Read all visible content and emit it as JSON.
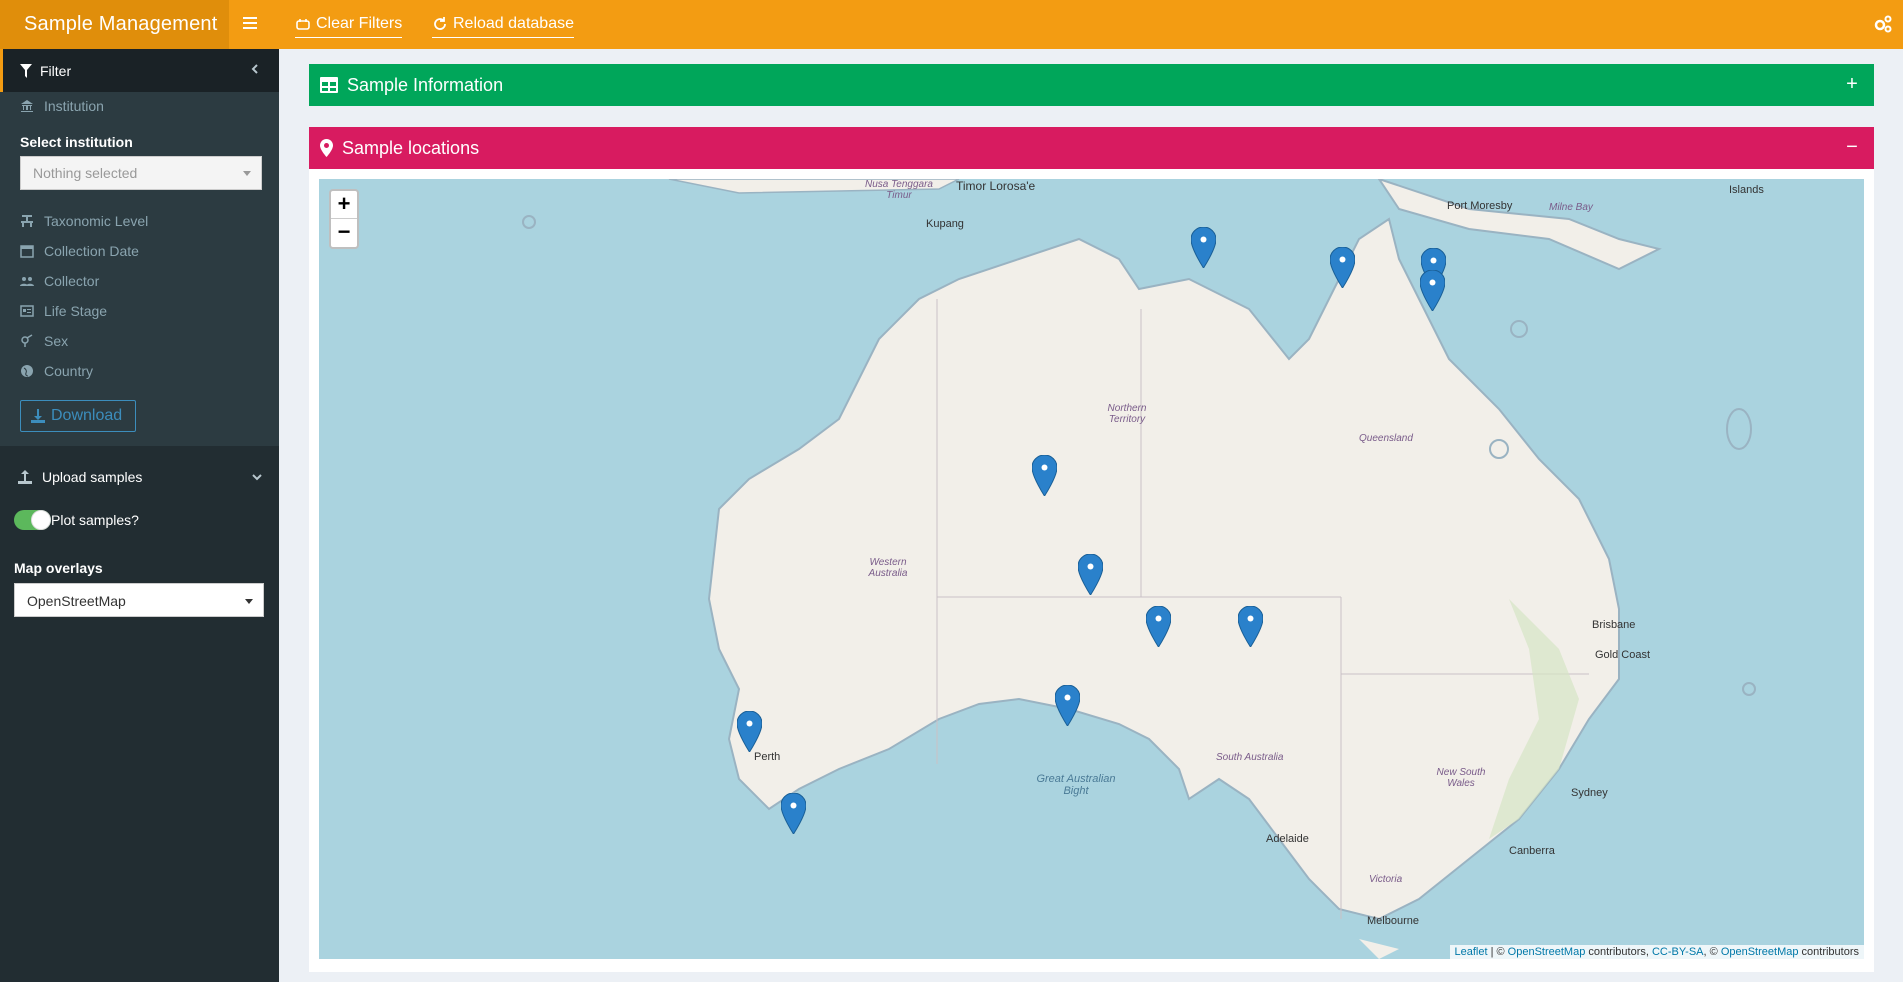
{
  "header": {
    "brand": "Sample Management",
    "clear_filters": "Clear Filters",
    "reload_database": "Reload database"
  },
  "sidebar": {
    "filter_title": "Filter",
    "institution": "Institution",
    "select_institution_label": "Select institution",
    "select_institution_placeholder": "Nothing selected",
    "items": [
      {
        "label": "Taxonomic Level",
        "icon": "sitemap-icon"
      },
      {
        "label": "Collection Date",
        "icon": "calendar-icon"
      },
      {
        "label": "Collector",
        "icon": "users-icon"
      },
      {
        "label": "Life Stage",
        "icon": "id-card-icon"
      },
      {
        "label": "Sex",
        "icon": "venus-mars-icon"
      },
      {
        "label": "Country",
        "icon": "globe-icon"
      }
    ],
    "download": "Download",
    "upload_samples": "Upload samples",
    "plot_samples": "Plot samples?",
    "plot_samples_on": true,
    "map_overlays_label": "Map overlays",
    "map_overlays_value": "OpenStreetMap"
  },
  "boxes": {
    "sample_information": "Sample Information",
    "sample_locations": "Sample locations",
    "expand_symbol": "+",
    "collapse_symbol": "−"
  },
  "map": {
    "zoom_in": "+",
    "zoom_out": "−",
    "attribution": {
      "leaflet": "Leaflet",
      "sep1": " | © ",
      "osm1": "OpenStreetMap",
      "mid": " contributors, ",
      "ccbysa": "CC-BY-SA",
      "sep2": ", © ",
      "osm2": "OpenStreetMap",
      "end": " contributors"
    },
    "labels": {
      "nusa_tenggara": "Nusa Tenggara Timur",
      "timor": "Timor Lorosa'e",
      "kupang": "Kupang",
      "port_moresby": "Port Moresby",
      "milne_bay": "Milne Bay",
      "islands": "Islands",
      "northern_territory": "Northern Territory",
      "queensland": "Queensland",
      "western_australia": "Western Australia",
      "south_australia": "South Australia",
      "new_south_wales": "New South Wales",
      "victoria": "Victoria",
      "great_australian_bight": "Great Australian Bight",
      "perth": "Perth",
      "adelaide": "Adelaide",
      "brisbane": "Brisbane",
      "gold_coast": "Gold Coast",
      "sydney": "Sydney",
      "canberra": "Canberra",
      "melbourne": "Melbourne"
    },
    "marker_count": 12
  },
  "colors": {
    "header": "#f39c12",
    "brand_bg": "#e08e0b",
    "sidebar": "#222d32",
    "box_green": "#00a65a",
    "box_pink": "#d81b60",
    "sea": "#aad3df",
    "land": "#f2efe9",
    "marker": "#2a81cb"
  }
}
